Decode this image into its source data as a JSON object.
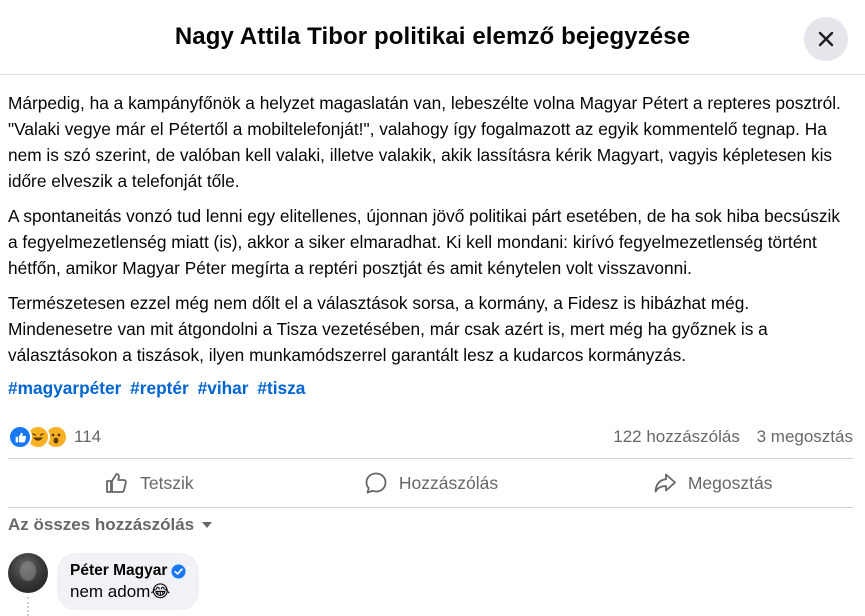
{
  "header": {
    "title": "Nagy Attila Tibor politikai elemző bejegyzése"
  },
  "post": {
    "paragraphs": [
      "Márpedig, ha a kampányfőnök a helyzet magaslatán van, lebeszélte volna Magyar Pétert a repteres posztról. \"Valaki vegye már el Pétertől a mobiltelefonját!\", valahogy így fogalmazott az egyik kommentelő tegnap. Ha nem is szó szerint, de valóban kell valaki, illetve valakik, akik lassításra kérik Magyart, vagyis képletesen kis időre elveszik a telefonját tőle.",
      "A spontaneitás vonzó tud lenni egy elitellenes, újonnan jövő politikai párt esetében, de ha sok hiba becsúszik a fegyelmezetlenség miatt (is), akkor a siker elmaradhat. Ki kell mondani: kirívó fegyelmezetlenség történt hétfőn, amikor Magyar Péter megírta a reptéri posztját és amit kénytelen volt visszavonni.",
      "Természetesen ezzel még nem dőlt el a választások sorsa, a kormány, a Fidesz is hibázhat még. Mindenesetre van mit átgondolni a Tisza vezetésében, már csak azért is, mert még ha győznek is a választásokon a tiszások, ilyen munkamódszerrel garantált lesz a kudarcos kormányzás."
    ],
    "hashtags": [
      "#magyarpéter",
      "#reptér",
      "#vihar",
      "#tisza"
    ]
  },
  "reactions": {
    "icons": [
      "like-icon",
      "haha-icon",
      "wow-icon"
    ],
    "count": "114",
    "comments": "122 hozzászólás",
    "shares": "3 megosztás"
  },
  "actions": {
    "like": "Tetszik",
    "comment": "Hozzászólás",
    "share": "Megosztás"
  },
  "sort": {
    "label": "Az összes hozzászólás"
  },
  "comment": {
    "author": "Péter Magyar",
    "text": "nem adom",
    "emoji": "😂"
  },
  "colors": {
    "accent": "#0064d1",
    "like_blue": "#1877f2",
    "muted": "#65676b",
    "bubble": "#f0f2f5"
  }
}
